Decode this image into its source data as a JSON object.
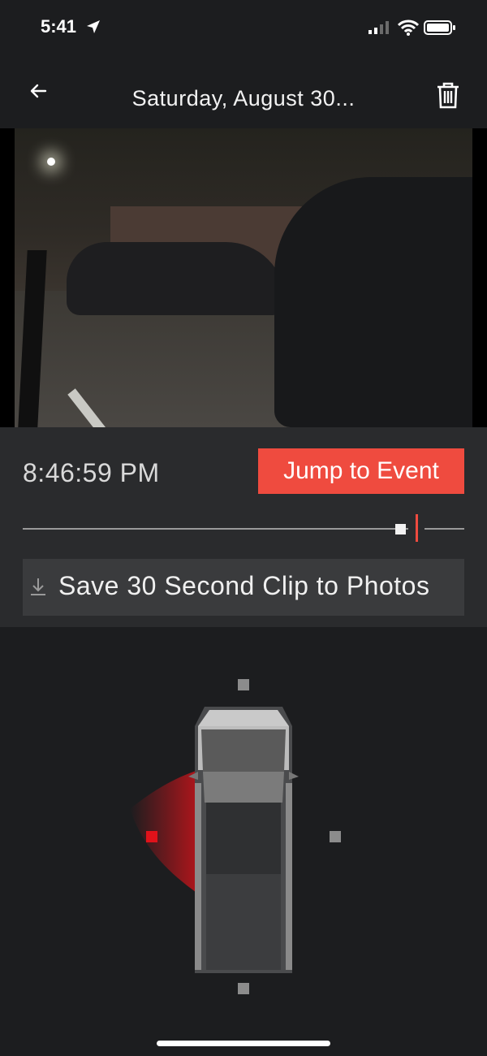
{
  "status_bar": {
    "time": "5:41",
    "location_icon": "location-arrow-icon",
    "signal_icon": "cellular-signal-icon",
    "wifi_icon": "wifi-icon",
    "battery_icon": "battery-icon"
  },
  "nav": {
    "back_icon": "back-arrow-icon",
    "title": "Saturday, August 30...",
    "delete_icon": "trash-icon"
  },
  "player": {
    "timestamp": "8:46:59 PM",
    "jump_label": "Jump to Event",
    "jump_color": "#ef4b3f",
    "scrubber_position": 0.9,
    "event_marker_position": 0.94,
    "save_label": "Save 30 Second Clip to Photos",
    "save_icon": "download-icon"
  },
  "cameras": {
    "vehicle_icon": "cybertruck-top-view-icon",
    "selected": "left",
    "selected_color": "#e0121a",
    "items": [
      "front",
      "left",
      "right",
      "rear"
    ]
  }
}
